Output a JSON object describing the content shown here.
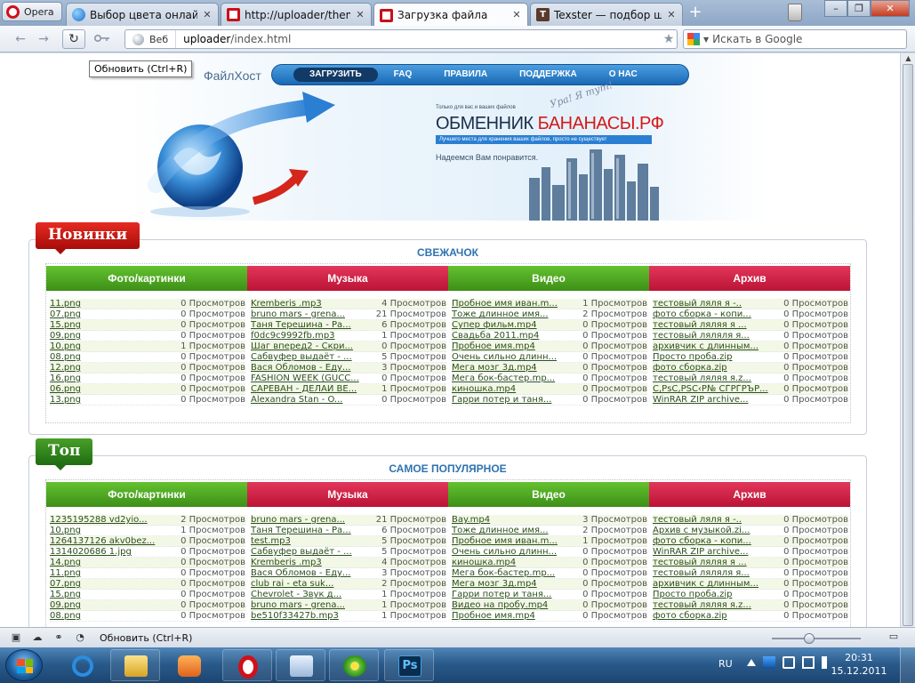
{
  "browser": {
    "menu_label": "Opera",
    "tabs": [
      {
        "label": "Выбор цвета онлайн ...",
        "icon": "globe-icon"
      },
      {
        "label": "http://uploader/theme...",
        "icon": "opera-icon"
      },
      {
        "label": "Загрузка файла",
        "icon": "opera-icon",
        "active": true
      },
      {
        "label": "Texster — подбор шр...",
        "icon": "texster-icon"
      }
    ],
    "new_tab": "+",
    "address": {
      "scope": "Веб",
      "host": "uploader",
      "path": "/index.html"
    },
    "search_placeholder": "Искать в Google",
    "tooltip": "Обновить (Ctrl+R)"
  },
  "site": {
    "logo": "ФайлХост",
    "nav": [
      "ЗАГРУЗИТЬ",
      "FAQ",
      "ПРАВИЛА",
      "ПОДДЕРЖКА",
      "О НАС"
    ],
    "banner": {
      "small": "Только для вас и ваших файлов",
      "title_main": "ОБМЕННИК ",
      "title_accent": "БАНАНАСЫ.РФ",
      "bar": "Лучшего места для хранения ваших файлов, просто не существует",
      "hope": "Надеемся Вам понравится.",
      "handwriting": "Ура! Я тут!"
    }
  },
  "sections": [
    {
      "ribbon": "Новинки",
      "title": "СВЕЖАЧОК",
      "columns": [
        {
          "header": "Фото/картинки",
          "rows": [
            {
              "name": "11.png",
              "views": "0 Просмотров"
            },
            {
              "name": "07.png",
              "views": "0 Просмотров"
            },
            {
              "name": "15.png",
              "views": "0 Просмотров"
            },
            {
              "name": "09.png",
              "views": "0 Просмотров"
            },
            {
              "name": "10.png",
              "views": "1 Просмотров"
            },
            {
              "name": "08.png",
              "views": "0 Просмотров"
            },
            {
              "name": "12.png",
              "views": "0 Просмотров"
            },
            {
              "name": "16.png",
              "views": "0 Просмотров"
            },
            {
              "name": "06.png",
              "views": "0 Просмотров"
            },
            {
              "name": "13.png",
              "views": "0 Просмотров"
            }
          ]
        },
        {
          "header": "Музыка",
          "rows": [
            {
              "name": "Kremberis .mp3",
              "views": "4 Просмотров"
            },
            {
              "name": "bruno mars - grena...",
              "views": "21 Просмотров"
            },
            {
              "name": "Таня Терешина - Ра...",
              "views": "6 Просмотров"
            },
            {
              "name": "f0dc9c9992fb.mp3",
              "views": "1 Просмотров"
            },
            {
              "name": "Шаг вперед2 - Скри...",
              "views": "0 Просмотров"
            },
            {
              "name": "Сабвуфер выдаёт - ...",
              "views": "5 Просмотров"
            },
            {
              "name": "Вася Обломов - Еду...",
              "views": "3 Просмотров"
            },
            {
              "name": "FASHION WEEK (GUCC...",
              "views": "0 Просмотров"
            },
            {
              "name": "САРЕВАН - ДЕЛАЙ ВЕ...",
              "views": "1 Просмотров"
            },
            {
              "name": "Alexandra Stan - O...",
              "views": "0 Просмотров"
            }
          ]
        },
        {
          "header": "Видео",
          "rows": [
            {
              "name": "Пробное имя иван.m...",
              "views": "1 Просмотров"
            },
            {
              "name": "Тоже длинное имя...",
              "views": "2 Просмотров"
            },
            {
              "name": "Супер фильм.mp4",
              "views": "0 Просмотров"
            },
            {
              "name": "Свадьба 2011.mp4",
              "views": "0 Просмотров"
            },
            {
              "name": "Пробное имя.mp4",
              "views": "0 Просмотров"
            },
            {
              "name": "Очень сильно длинн...",
              "views": "0 Просмотров"
            },
            {
              "name": "Мега мозг 3д.mp4",
              "views": "0 Просмотров"
            },
            {
              "name": "Мега бок-бастер.mp...",
              "views": "0 Просмотров"
            },
            {
              "name": "киношка.mp4",
              "views": "0 Просмотров"
            },
            {
              "name": "Гарри потер и таня...",
              "views": "0 Просмотров"
            }
          ]
        },
        {
          "header": "Архив",
          "rows": [
            {
              "name": "тестовый ляля я -..",
              "views": "0 Просмотров"
            },
            {
              "name": "фото сборка - копи...",
              "views": "0 Просмотров"
            },
            {
              "name": "тестовый ляляя я ...",
              "views": "0 Просмотров"
            },
            {
              "name": "тестовый ляляля я...",
              "views": "0 Просмотров"
            },
            {
              "name": "архивчик с длинным...",
              "views": "0 Просмотров"
            },
            {
              "name": "Просто проба.zip",
              "views": "0 Просмотров"
            },
            {
              "name": "фото сборка.zip",
              "views": "0 Просмотров"
            },
            {
              "name": "тестовый ляляя я.z...",
              "views": "0 Просмотров"
            },
            {
              "name": "С‚РѕС‚РЅС‹Р№ СЃРЃРЪР...",
              "views": "0 Просмотров"
            },
            {
              "name": "WinRAR ZIP archive...",
              "views": "0 Просмотров"
            }
          ]
        }
      ]
    },
    {
      "ribbon": "Топ",
      "title": "САМОЕ ПОПУЛЯРНОЕ",
      "columns": [
        {
          "header": "Фото/картинки",
          "rows": [
            {
              "name": "1235195288 vd2yio...",
              "views": "2 Просмотров"
            },
            {
              "name": "10.png",
              "views": "1 Просмотров"
            },
            {
              "name": "1264137126 akv0bez...",
              "views": "0 Просмотров"
            },
            {
              "name": "1314020686 1.jpg",
              "views": "0 Просмотров"
            },
            {
              "name": "14.png",
              "views": "0 Просмотров"
            },
            {
              "name": "11.png",
              "views": "0 Просмотров"
            },
            {
              "name": "07.png",
              "views": "0 Просмотров"
            },
            {
              "name": "15.png",
              "views": "0 Просмотров"
            },
            {
              "name": "09.png",
              "views": "0 Просмотров"
            },
            {
              "name": "08.png",
              "views": "0 Просмотров"
            }
          ]
        },
        {
          "header": "Музыка",
          "rows": [
            {
              "name": "bruno mars - grena...",
              "views": "21 Просмотров"
            },
            {
              "name": "Таня Терешина - Ра...",
              "views": "6 Просмотров"
            },
            {
              "name": "test.mp3",
              "views": "5 Просмотров"
            },
            {
              "name": "Сабвуфер выдаёт - ...",
              "views": "5 Просмотров"
            },
            {
              "name": "Kremberis .mp3",
              "views": "4 Просмотров"
            },
            {
              "name": "Вася Обломов - Еду...",
              "views": "3 Просмотров"
            },
            {
              "name": "club rai - eta suk...",
              "views": "2 Просмотров"
            },
            {
              "name": "Chevrolet - Звук д...",
              "views": "1 Просмотров"
            },
            {
              "name": "bruno mars - grena...",
              "views": "1 Просмотров"
            },
            {
              "name": "be510f33427b.mp3",
              "views": "1 Просмотров"
            }
          ]
        },
        {
          "header": "Видео",
          "rows": [
            {
              "name": "Bay.mp4",
              "views": "3 Просмотров"
            },
            {
              "name": "Тоже длинное имя...",
              "views": "2 Просмотров"
            },
            {
              "name": "Пробное имя иван.m...",
              "views": "1 Просмотров"
            },
            {
              "name": "Очень сильно длинн...",
              "views": "0 Просмотров"
            },
            {
              "name": "киношка.mp4",
              "views": "0 Просмотров"
            },
            {
              "name": "Мега бок-бастер.mp...",
              "views": "0 Просмотров"
            },
            {
              "name": "Мега мозг 3д.mp4",
              "views": "0 Просмотров"
            },
            {
              "name": "Гарри потер и таня...",
              "views": "0 Просмотров"
            },
            {
              "name": "Видео на пробу.mp4",
              "views": "0 Просмотров"
            },
            {
              "name": "Пробное имя.mp4",
              "views": "0 Просмотров"
            }
          ]
        },
        {
          "header": "Архив",
          "rows": [
            {
              "name": "тестовый ляля я -..",
              "views": "0 Просмотров"
            },
            {
              "name": "Архив с музыкой.zi...",
              "views": "0 Просмотров"
            },
            {
              "name": "фото сборка - копи...",
              "views": "0 Просмотров"
            },
            {
              "name": "WinRAR ZIP archive...",
              "views": "0 Просмотров"
            },
            {
              "name": "тестовый ляляя я ...",
              "views": "0 Просмотров"
            },
            {
              "name": "тестовый ляляля я...",
              "views": "0 Просмотров"
            },
            {
              "name": "архивчик с длинным...",
              "views": "0 Просмотров"
            },
            {
              "name": "Просто проба.zip",
              "views": "0 Просмотров"
            },
            {
              "name": "тестовый ляляя я.z...",
              "views": "0 Просмотров"
            },
            {
              "name": "фото сборка.zip",
              "views": "0 Просмотров"
            }
          ]
        }
      ]
    }
  ],
  "statusbar": {
    "text": "Обновить (Ctrl+R)"
  },
  "taskbar": {
    "lang": "RU",
    "time": "20:31",
    "date": "15.12.2011"
  },
  "colors": {
    "header_green": "#4fa823",
    "header_red": "#cf2146",
    "ribbon_red": "#d01a14",
    "ribbon_green": "#2f8a1a",
    "nav_blue": "#2a7fd2",
    "link_green": "#2b4f1a"
  }
}
